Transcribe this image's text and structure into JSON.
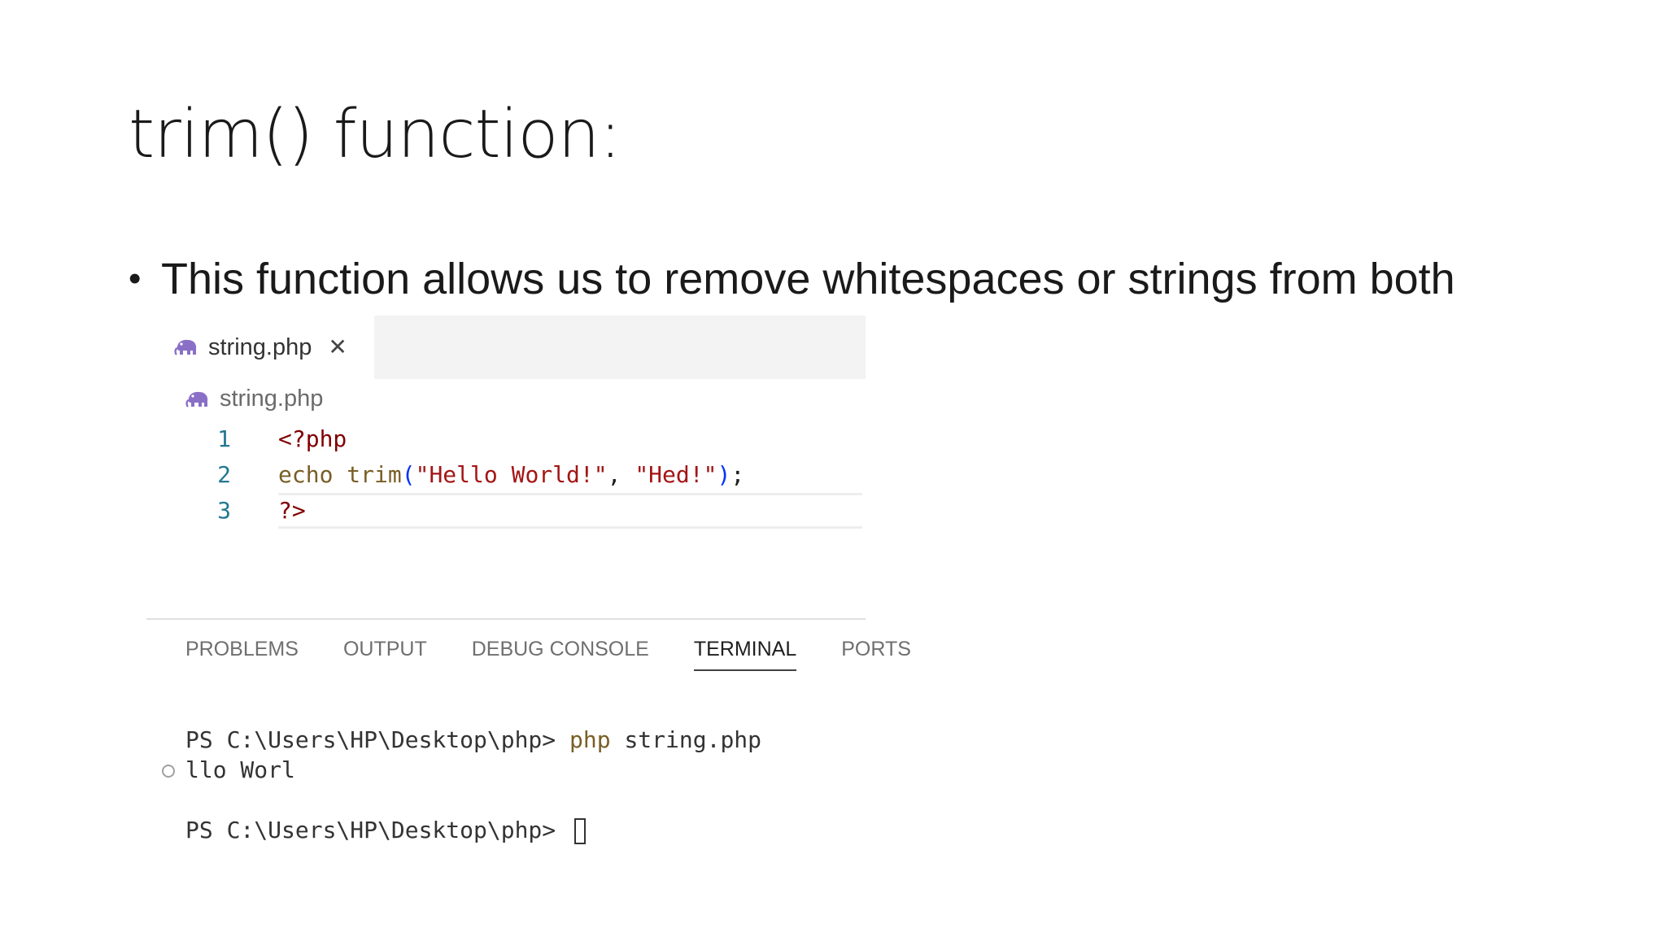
{
  "slide": {
    "title": "trim() function:",
    "bullet_text": "This function allows us to remove whitespaces or strings from both"
  },
  "editor": {
    "tab": {
      "file_name": "string.php",
      "close_glyph": "✕",
      "icon": "php-elephant-icon"
    },
    "breadcrumb": {
      "file_name": "string.php",
      "icon": "php-elephant-icon"
    },
    "code_lines": [
      {
        "number": "1",
        "open_tag": "<?php"
      },
      {
        "number": "2",
        "keyword": "echo",
        "function": "trim",
        "open_paren": "(",
        "arg1": "\"Hello World!\"",
        "comma": ", ",
        "arg2": "\"Hed!\"",
        "close_paren": ")",
        "semicolon": ";"
      },
      {
        "number": "3",
        "close_tag": "?>"
      }
    ],
    "colors": {
      "line_number": "#237893",
      "tag": "#800000",
      "function": "#795e26",
      "string": "#a31515",
      "paren": "#0431fa"
    }
  },
  "panel": {
    "tabs": [
      {
        "label": "PROBLEMS",
        "active": false
      },
      {
        "label": "OUTPUT",
        "active": false
      },
      {
        "label": "DEBUG CONSOLE",
        "active": false
      },
      {
        "label": "TERMINAL",
        "active": true
      },
      {
        "label": "PORTS",
        "active": false
      }
    ]
  },
  "terminal": {
    "line1_prompt": "PS C:\\Users\\HP\\Desktop\\php> ",
    "line1_cmd": "php",
    "line1_arg": " string.php",
    "line2_output": "llo Worl",
    "line3_prompt": "PS C:\\Users\\HP\\Desktop\\php> "
  }
}
